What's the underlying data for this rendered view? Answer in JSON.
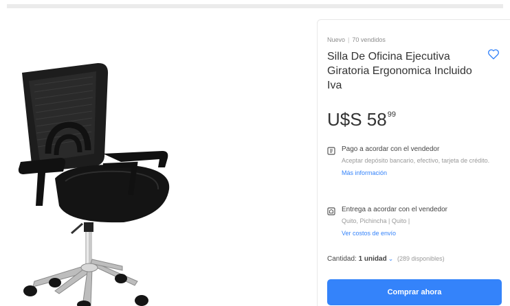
{
  "product": {
    "condition": "Nuevo",
    "sold": "70 vendidos",
    "title": "Silla De Oficina Ejecutiva Giratoria Ergonomica Incluido Iva",
    "price_integer": "U$S 58",
    "price_cents": "99"
  },
  "payment": {
    "icon": "payment-icon",
    "title": "Pago a acordar con el vendedor",
    "detail": "Aceptar depósito bancario, efectivo, tarjeta de crédito.",
    "link": "Más información"
  },
  "delivery": {
    "icon": "delivery-icon",
    "title": "Entrega a acordar con el vendedor",
    "detail": "Quito, Pichincha | Quito |",
    "link": "Ver costos de envío"
  },
  "quantity": {
    "label": "Cantidad:",
    "value": "1 unidad",
    "available": "(289 disponibles)"
  },
  "actions": {
    "buy_label": "Comprar ahora",
    "favorite_icon": "heart-icon"
  },
  "colors": {
    "accent": "#3483fa",
    "text": "#333333",
    "muted": "#999999"
  }
}
